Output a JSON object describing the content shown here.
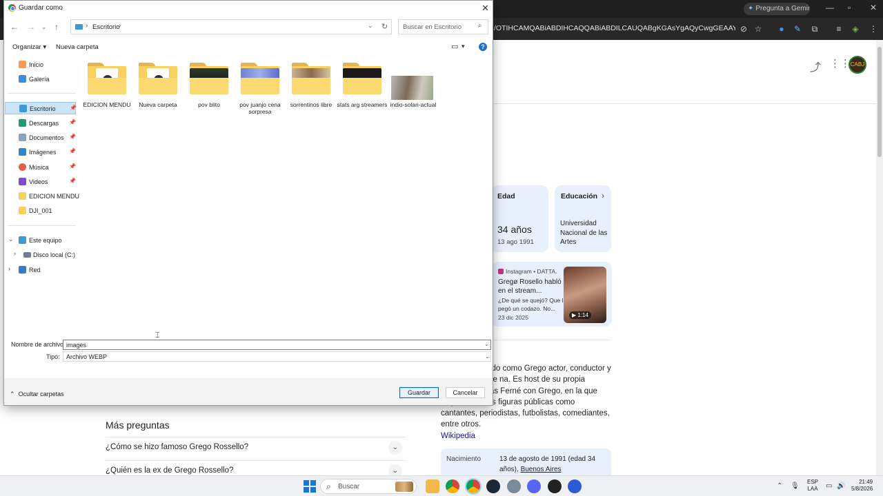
{
  "browser": {
    "gemini_button": "Pregunta a Gemini",
    "url": "/OTIHCAMQABiABDIHCAQQABiABDILCAUQABgKGAsYgAQyCwgGEAAYChgLGIAEM...",
    "knowledge": {
      "age_card": {
        "title": "Edad",
        "value": "34 años",
        "sub": "13 ago 1991"
      },
      "edu_card": {
        "title": "Educación",
        "value": "Universidad Nacional de las Artes"
      },
      "video_card": {
        "source": "Instagram • DATTA.",
        "title": "Gregø Rosello habló en el stream...",
        "desc": "¿De qué se quejó? Que le pegó un codazo. No...",
        "date": "23 dic 2025",
        "duration": "▶ 1:14"
      },
      "description_prefix": "lo, más conocido como Grego actor, conductor y personalidad de na. Es host de su propia sección de adas Ferné con Grego, en la que aloja a diversas figuras públicas como cantantes, periodistas, futbolistas, comediantes, entre otros.",
      "wikipedia": "Wikipedia",
      "birth_label": "Nacimiento",
      "birth_value": "13 de agosto de 1991 (edad 34 años),",
      "birth_place": "Buenos Aires"
    },
    "more_questions": {
      "title": "Más preguntas",
      "items": [
        "¿Cómo se hizo famoso Grego Rossello?",
        "¿Quién es la ex de Grego Rossello?"
      ]
    }
  },
  "dialog": {
    "title": "Guardar como",
    "breadcrumb": "Escritorio",
    "search_placeholder": "Buscar en Escritorio",
    "organize": "Organizar",
    "new_folder": "Nueva carpeta",
    "nav": {
      "home": "Inicio",
      "gallery": "Galería",
      "desktop": "Escritorio",
      "downloads": "Descargas",
      "documents": "Documentos",
      "images": "Imágenes",
      "music": "Música",
      "videos": "Videos",
      "edicion": "EDICION MENDU",
      "dji": "DJI_001",
      "this_pc": "Este equipo",
      "local_disk": "Disco local (C:)",
      "network": "Red"
    },
    "files": [
      "EDICION MENDU",
      "Nueva carpeta",
      "pov blito",
      "pov juanjo cena sorpresa",
      "sorrentinos libre",
      "stats arg streamers",
      "indio-solari-actual"
    ],
    "filename_label": "Nombre de archivo:",
    "filename_value": "images",
    "type_label": "Tipo:",
    "type_value": "Archivo WEBP",
    "hide_folders": "Ocultar carpetas",
    "save": "Guardar",
    "cancel": "Cancelar"
  },
  "taskbar": {
    "search": "Buscar",
    "lang": "ESP",
    "lang2": "LAA",
    "time": "21:49",
    "date": "5/8/2026"
  },
  "colors": {
    "accent": "#0067c0",
    "folder": "#f9cf5f",
    "card_bg": "#e8f0fe",
    "link": "#1a0dab"
  }
}
